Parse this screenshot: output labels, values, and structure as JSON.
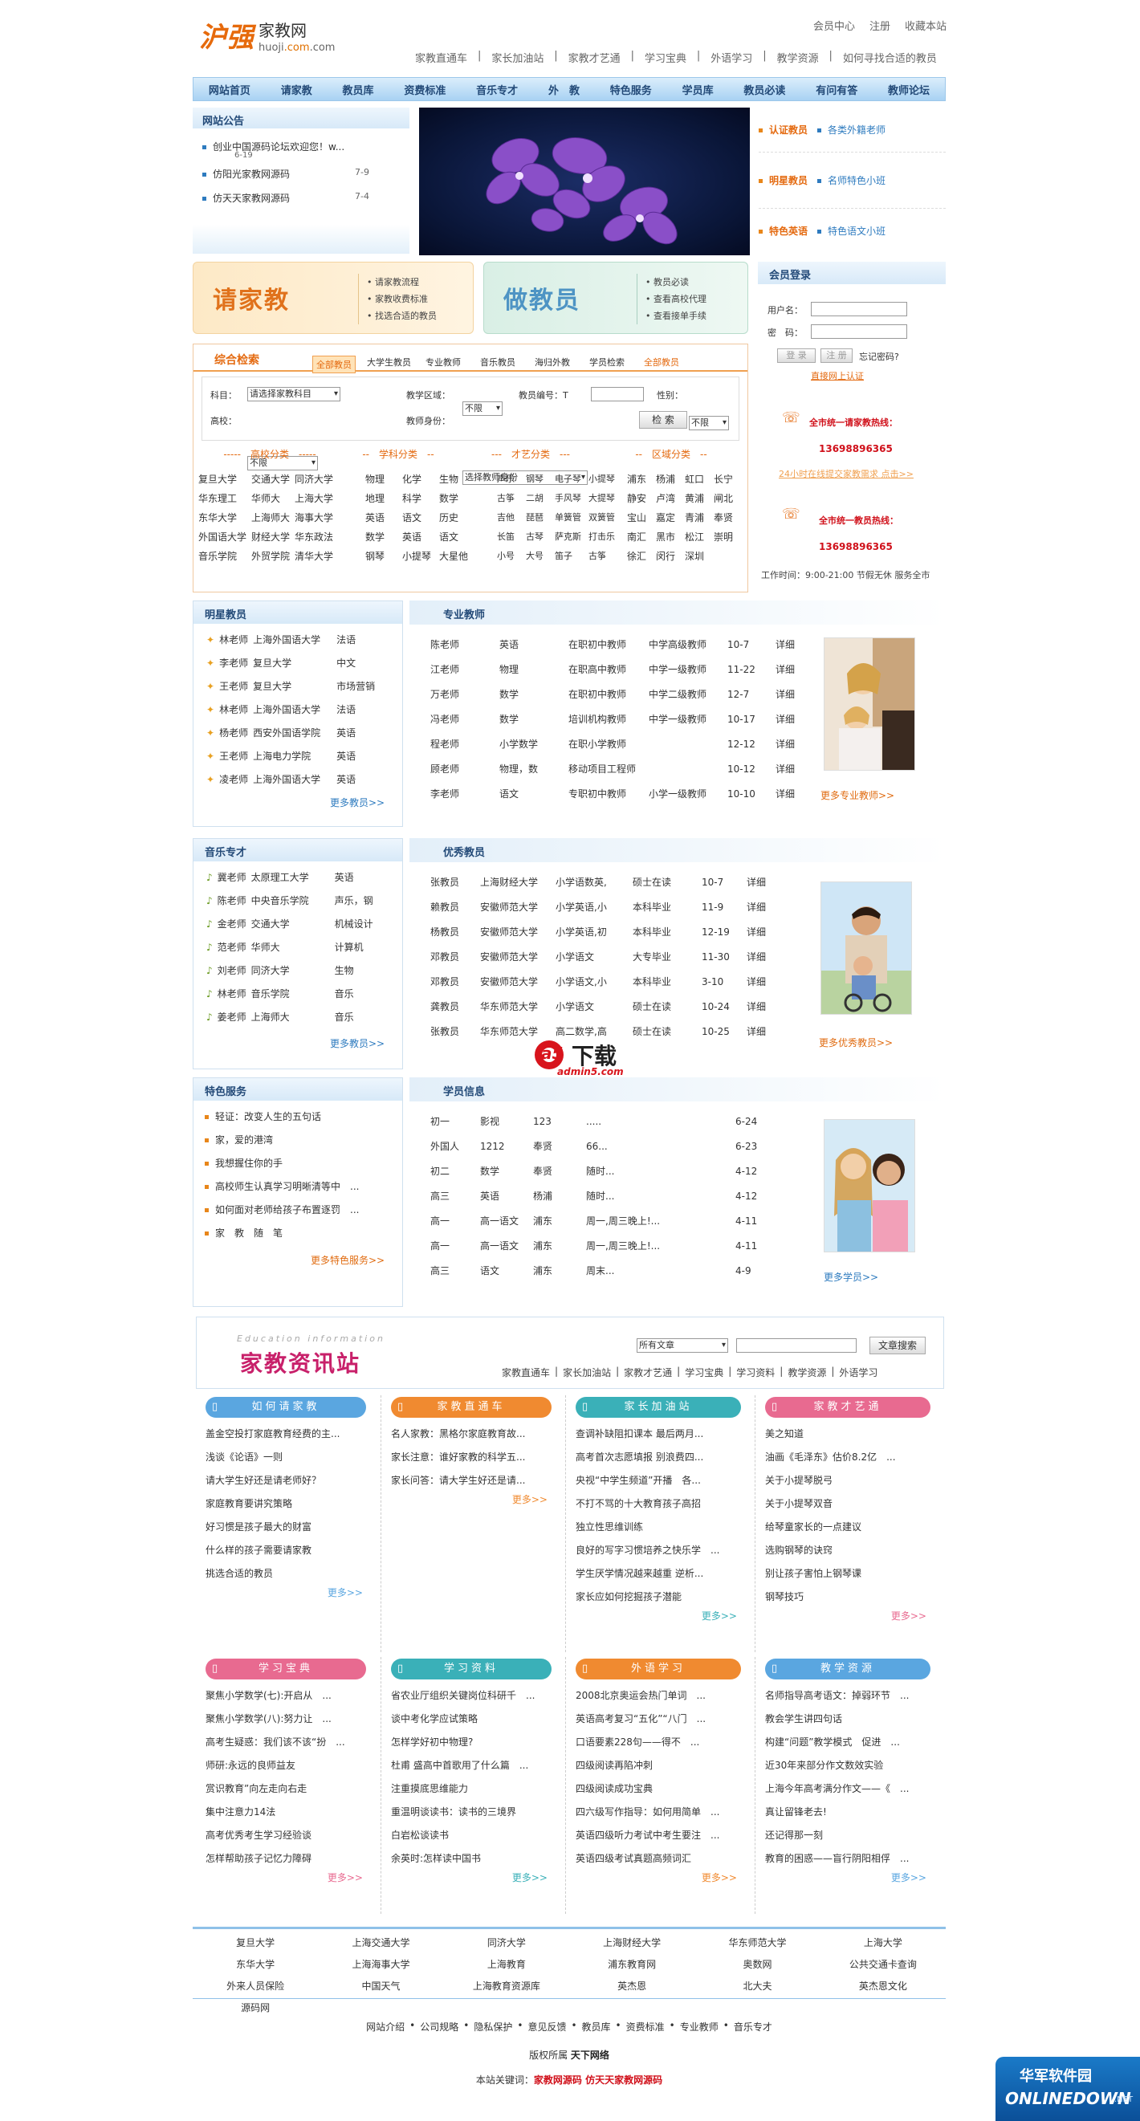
{
  "logo": {
    "cn": "沪强",
    "name": "家教网",
    "domain_a": "huoji",
    "domain_b": ".com",
    "domain_c": ".com"
  },
  "top_links": [
    "会员中心",
    "注册",
    "收藏本站"
  ],
  "sub_nav": [
    "家教直通车",
    "|",
    "家长加油站",
    "|",
    "家教才艺通",
    "|",
    "学习宝典",
    "|",
    "外语学习",
    "|",
    "教学资源",
    "|",
    "如何寻找合适的教员"
  ],
  "main_nav": [
    "网站首页",
    "请家教",
    "教员库",
    "资费标准",
    "音乐专才",
    "外　教",
    "特色服务",
    "学员库",
    "教员必读",
    "有问有答",
    "教师论坛"
  ],
  "notice": {
    "title": "网站公告",
    "items": [
      {
        "text": "创业中国源码论坛欢迎您！w...",
        "date": "6-19"
      },
      {
        "text": "仿阳光家教网源码",
        "date": "7-9"
      },
      {
        "text": "仿天天家教网源码",
        "date": "7-4"
      }
    ]
  },
  "right_links": [
    {
      "a": "认证教员",
      "b": "各类外籍老师"
    },
    {
      "a": "明星教员",
      "b": "名师特色小班"
    },
    {
      "a": "特色英语",
      "b": "特色语文小班"
    }
  ],
  "banner_left": {
    "title": "请家教",
    "links": [
      "请家教流程",
      "家教收费标准",
      "找选合适的教员"
    ]
  },
  "banner_right": {
    "title": "做教员",
    "links": [
      "教员必读",
      "查看高校代理",
      "查看接单手续"
    ]
  },
  "search": {
    "title": "综合检索",
    "tabs": [
      "全部教员",
      "大学生教员",
      "专业教师",
      "音乐教员",
      "海归外教",
      "学员检索",
      "全部教员"
    ],
    "labels": {
      "subject": "科目：",
      "area": "教学区域：",
      "id": "教员编号：T",
      "sex": "性别：",
      "school": "高校：",
      "identity": "教师身份："
    },
    "values": {
      "subject": "请选择家教科目",
      "area": "不限",
      "sex": "不限",
      "school": "不限",
      "identity": "选择教师身份"
    },
    "btn": "检 索",
    "cats": [
      "-----　高校分类　-----",
      "--　学科分类　--",
      "---　才艺分类　---",
      "--　区域分类　--"
    ],
    "schools": [
      [
        "复旦大学",
        "交通大学",
        "同济大学"
      ],
      [
        "华东理工",
        "华师大",
        "上海大学"
      ],
      [
        "东华大学",
        "上海师大",
        "海事大学"
      ],
      [
        "外国语大学",
        "财经大学",
        "华东政法"
      ],
      [
        "音乐学院",
        "外贸学院",
        "清华大学"
      ]
    ],
    "subjects": [
      [
        "物理",
        "化学",
        "生物"
      ],
      [
        "地理",
        "科学",
        "数学"
      ],
      [
        "英语",
        "语文",
        "历史"
      ],
      [
        "数学",
        "英语",
        "语文"
      ],
      [
        "钢琴",
        "小提琴",
        "大星他"
      ]
    ],
    "arts": [
      [
        "声乐",
        "钢琴",
        "电子琴",
        "小提琴"
      ],
      [
        "古筝",
        "二胡",
        "手风琴",
        "大提琴"
      ],
      [
        "吉他",
        "琵琶",
        "单簧管",
        "双簧管"
      ],
      [
        "长笛",
        "古琴",
        "萨克斯",
        "打击乐"
      ],
      [
        "小号",
        "大号",
        "笛子",
        "古筝"
      ]
    ],
    "areas": [
      [
        "浦东",
        "杨浦",
        "虹口",
        "长宁"
      ],
      [
        "静安",
        "卢湾",
        "黄浦",
        "闸北"
      ],
      [
        "宝山",
        "嘉定",
        "青浦",
        "奉贤"
      ],
      [
        "南汇",
        "黑市",
        "松江",
        "崇明"
      ],
      [
        "徐汇",
        "闵行",
        "深圳",
        ""
      ]
    ]
  },
  "login": {
    "title": "会员登录",
    "user": "用户名：",
    "pass": "密　码：",
    "login": "登 录",
    "reg": "注 册",
    "forgot": "忘记密码?",
    "cert": "直接网上认证",
    "hot1": "全市统一请家教热线：",
    "phone1": "13698896365",
    "online": "24小时在线提交家教需求 点击>>",
    "hot2": "全市统一教员热线：",
    "phone2": "13698896365",
    "hours": "工作时间：9:00-21:00 节假无休 服务全市"
  },
  "star": {
    "title": "明星教员",
    "items": [
      [
        "林老师",
        "上海外国语大学",
        "法语"
      ],
      [
        "李老师",
        "复旦大学",
        "中文"
      ],
      [
        "王老师",
        "复旦大学",
        "市场营销"
      ],
      [
        "林老师",
        "上海外国语大学",
        "法语"
      ],
      [
        "杨老师",
        "西安外国语学院",
        "英语"
      ],
      [
        "王老师",
        "上海电力学院",
        "英语"
      ],
      [
        "凌老师",
        "上海外国语大学",
        "英语"
      ]
    ],
    "more": "更多教员>>"
  },
  "pro": {
    "title": "专业教师",
    "rows": [
      [
        "陈老师",
        "英语",
        "在职初中教师",
        "中学高级教师",
        "10-7",
        "详细"
      ],
      [
        "江老师",
        "物理",
        "在职高中教师",
        "中学一级教师",
        "11-22",
        "详细"
      ],
      [
        "万老师",
        "数学",
        "在职初中教师",
        "中学二级教师",
        "12-7",
        "详细"
      ],
      [
        "冯老师",
        "数学",
        "培训机构教师",
        "中学一级教师",
        "10-17",
        "详细"
      ],
      [
        "程老师",
        "小学数学",
        "在职小学教师",
        "",
        "12-12",
        "详细"
      ],
      [
        "顾老师",
        "物理，数",
        "移动项目工程师",
        "",
        "10-12",
        "详细"
      ],
      [
        "李老师",
        "语文",
        "专职初中教师",
        "小学一级教师",
        "10-10",
        "详细"
      ]
    ],
    "more": "更多专业教师>>"
  },
  "music": {
    "title": "音乐专才",
    "items": [
      [
        "冀老师",
        "太原理工大学",
        "英语"
      ],
      [
        "陈老师",
        "中央音乐学院",
        "声乐，钢"
      ],
      [
        "金老师",
        "交通大学",
        "机械设计"
      ],
      [
        "范老师",
        "华师大",
        "计算机"
      ],
      [
        "刘老师",
        "同济大学",
        "生物"
      ],
      [
        "林老师",
        "音乐学院",
        "音乐"
      ],
      [
        "姜老师",
        "上海师大",
        "音乐"
      ]
    ],
    "more": "更多教员>>"
  },
  "excellent": {
    "title": "优秀教员",
    "rows": [
      [
        "张教员",
        "上海财经大学",
        "小学语数英,",
        "硕士在读",
        "10-7",
        "详细"
      ],
      [
        "赖教员",
        "安徽师范大学",
        "小学英语,小",
        "本科毕业",
        "11-9",
        "详细"
      ],
      [
        "杨教员",
        "安徽师范大学",
        "小学英语,初",
        "本科毕业",
        "12-19",
        "详细"
      ],
      [
        "邓教员",
        "安徽师范大学",
        "小学语文",
        "大专毕业",
        "11-30",
        "详细"
      ],
      [
        "邓教员",
        "安徽师范大学",
        "小学语文,小",
        "本科毕业",
        "3-10",
        "详细"
      ],
      [
        "龚教员",
        "华东师范大学",
        "小学语文",
        "硕士在读",
        "10-24",
        "详细"
      ],
      [
        "张教员",
        "华东师范大学",
        "高二数学,高",
        "硕士在读",
        "10-25",
        "详细"
      ]
    ],
    "more": "更多优秀教员>>"
  },
  "watermark": {
    "a": "a5",
    "b": "下载",
    "c": "admin5.com"
  },
  "special": {
    "title": "特色服务",
    "items": [
      "轻证：改变人生的五句话",
      "家，爱的港湾",
      "我想握住你的手",
      "高校师生认真学习明晰清等中　...",
      "如何面对老师给孩子布置逐罚　...",
      "家　教　随　笔"
    ],
    "more": "更多特色服务>>"
  },
  "students": {
    "title": "学员信息",
    "rows": [
      [
        "初一",
        "影视",
        "123",
        ".....",
        "6-24"
      ],
      [
        "外国人",
        "1212",
        "奉贤",
        "66...",
        "6-23"
      ],
      [
        "初二",
        "数学",
        "奉贤",
        "随时...",
        "4-12"
      ],
      [
        "高三",
        "英语",
        "杨浦",
        "随时...",
        "4-12"
      ],
      [
        "高一",
        "高一语文",
        "浦东",
        "周一,周三晚上!...",
        "4-11"
      ],
      [
        "高一",
        "高一语文",
        "浦东",
        "周一,周三晚上!...",
        "4-11"
      ],
      [
        "高三",
        "语文",
        "浦东",
        "周末...",
        "4-9"
      ]
    ],
    "more": "更多学员>>"
  },
  "info": {
    "eng": "Education information",
    "title": "家教资讯站",
    "select": "所有文章",
    "btn": "文章搜索",
    "links": [
      "家教直通车",
      "|",
      "家长加油站",
      "|",
      "家教才艺通",
      "|",
      "学习宝典",
      "|",
      "学习资料",
      "|",
      "教学资源",
      "|",
      "外语学习"
    ]
  },
  "cols1": [
    {
      "title": "如何请家教",
      "color": "#5aa6e0",
      "items": [
        "盖金空投打家庭教育经费的主...",
        "浅谈《论语》一则",
        "请大学生好还是请老师好？",
        "家庭教育要讲究策略",
        "好习惯是孩子最大的财富",
        "什么样的孩子需要请家教",
        "挑选合适的教员"
      ],
      "more": "更多>>"
    },
    {
      "title": "家教直通车",
      "color": "#f08a30",
      "items": [
        "名人家教：黑格尔家庭教育故...",
        "家长注意：谁好家教的科学五...",
        "家长问答：请大学生好还是请..."
      ],
      "more": "更多>>"
    },
    {
      "title": "家长加油站",
      "color": "#3ab0b8",
      "items": [
        "查调补缺阻扣课本 最后两月...",
        "高考首次志愿填报 别浪费四...",
        "央视“中学生频道”开播　各...",
        "不打不骂的十大教育孩子高招",
        "独立性思维训练",
        "良好的写字习惯培养之快乐学　...",
        "学生厌学情况越来越重 逆析...",
        "家长应如何挖掘孩子潜能"
      ],
      "more": "更多>>"
    },
    {
      "title": "家教才艺通",
      "color": "#e86a90",
      "items": [
        "美之知道",
        "油画《毛泽东》估价8.2亿　...",
        "关于小提琴脱弓",
        "关于小提琴双音",
        "给琴童家长的一点建议",
        "选购钢琴的诀窍",
        "别让孩子害怕上钢琴课",
        "钢琴技巧"
      ],
      "more": "更多>>"
    }
  ],
  "cols2": [
    {
      "title": "学习宝典",
      "color": "#e86a90",
      "items": [
        "聚焦小学数学(七):开启从　...",
        "聚焦小学数学(八):努力让　...",
        "高考生疑惑：我们该不该“扮　...",
        "师研:永远的良师益友",
        "赏识教育”向左走向右走",
        "集中注意力14法",
        "高考优秀考生学习经验谈",
        "怎样帮助孩子记忆力障碍"
      ],
      "more": "更多>>"
    },
    {
      "title": "学习资料",
      "color": "#3ab0b8",
      "items": [
        "省农业厅组织关键岗位科研千　...",
        "谈中考化学应试策略",
        "怎样学好初中物理?",
        "杜甫 盛高中首歌用了什么篇　...",
        "注重摸底思维能力",
        "重温明谈读书：读书的三境界",
        "白岩松谈读书",
        "余英时:怎样读中国书"
      ],
      "more": "更多>>"
    },
    {
      "title": "外语学习",
      "color": "#f08a30",
      "items": [
        "2008北京奥运会热门单词　...",
        "英语高考复习“五化”“八门　...",
        "口语要素228句——得不　...",
        "四级阅读再陷冲刺",
        "四级阅读成功宝典",
        "四六级写作指导：如何用简单　...",
        "英语四级听力考试中考生要注　...",
        "英语四级考试真题高频词汇"
      ],
      "more": "更多>>"
    },
    {
      "title": "教学资源",
      "color": "#5aa6e0",
      "items": [
        "名师指导高考语文：掉弱环节　...",
        "教会学生讲四句话",
        "构建“问题”教学模式　促进　...",
        "近30年来部分作文数效实验",
        "上海今年高考满分作文——《　...",
        "真让留锋老去!",
        "还记得那一刻",
        "教育的困惑——盲行阴阳相俘　..."
      ],
      "more": "更多>>"
    }
  ],
  "friend_links": [
    "复旦大学",
    "上海交通大学",
    "同济大学",
    "上海财经大学",
    "华东师范大学",
    "上海大学",
    "东华大学",
    "上海海事大学",
    "上海教育",
    "浦东教育网",
    "奥数网",
    "公共交通卡查询",
    "外来人员保险",
    "中国天气",
    "上海教育资源库",
    "英杰恩",
    "北大夫",
    "英杰恩文化",
    "源码网"
  ],
  "footer": {
    "links": [
      "网站介绍",
      "公司规略",
      "隐私保护",
      "意见反馈",
      "教员库",
      "资费标准",
      "专业教师",
      "音乐专才"
    ],
    "copy": "版权所属 ",
    "copy_b": "天下网络",
    "kw": "本站关键词：",
    "kw_b": "家教网源码 仿天天家教网源码"
  },
  "corner": {
    "a": "华军软件园",
    "b": "ONLINEDOWN",
    "c": ".NET"
  }
}
